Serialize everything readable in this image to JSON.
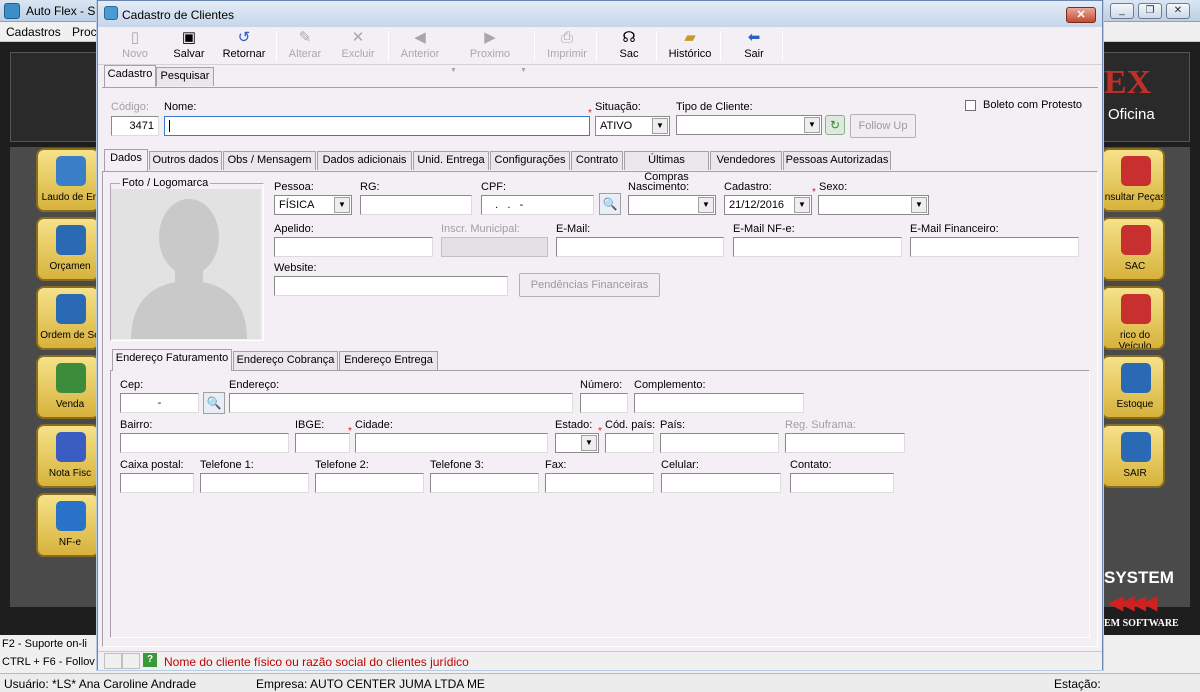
{
  "background_app": {
    "title": "Auto Flex - Si",
    "menu": [
      "Cadastros",
      "Proc"
    ],
    "brand_text": "EX",
    "brand_subtext": "Oficina",
    "left_tiles": [
      "Laudo de En",
      "Orçamen",
      "Ordem de Se",
      "Venda",
      "Nota Fisc",
      "NF-e"
    ],
    "right_tiles": [
      "nsultar Peças",
      "SAC",
      "rico do Veículo",
      "Estoque",
      "SAIR"
    ],
    "system_text": "SYSTEM",
    "arrows_text": "◀◀◀◀",
    "system_subtext": "EM SOFTWARE",
    "shortcuts": [
      "F2 - Suporte on-li",
      "CTRL + F6 - Follov"
    ],
    "status": {
      "usuario": "Usuário: *LS* Ana Caroline Andrade",
      "empresa": "Empresa: AUTO CENTER JUMA LTDA ME",
      "estacao": "Estação:"
    }
  },
  "dialog": {
    "title": "Cadastro de Clientes",
    "toolbar": [
      {
        "id": "novo",
        "label": "Novo",
        "icon": "new-doc-icon",
        "enabled": false
      },
      {
        "id": "salvar",
        "label": "Salvar",
        "icon": "floppy-disk-icon",
        "enabled": true
      },
      {
        "id": "retornar",
        "label": "Retornar",
        "icon": "undo-icon",
        "enabled": true
      },
      {
        "id": "alterar",
        "label": "Alterar",
        "icon": "pencil-icon",
        "enabled": false
      },
      {
        "id": "excluir",
        "label": "Excluir",
        "icon": "delete-x-icon",
        "enabled": false
      },
      {
        "id": "anterior",
        "label": "Anterior",
        "icon": "arrow-left-icon",
        "enabled": false
      },
      {
        "id": "proximo",
        "label": "Proximo",
        "icon": "arrow-right-icon",
        "enabled": false
      },
      {
        "id": "imprimir",
        "label": "Imprimir",
        "icon": "printer-icon",
        "enabled": false
      },
      {
        "id": "sac",
        "label": "Sac",
        "icon": "headset-icon",
        "enabled": true
      },
      {
        "id": "historico",
        "label": "Histórico",
        "icon": "folder-open-icon",
        "enabled": true
      },
      {
        "id": "sair",
        "label": "Sair",
        "icon": "exit-arrow-icon",
        "enabled": true
      }
    ],
    "top_tabs": [
      "Cadastro",
      "Pesquisar"
    ],
    "header": {
      "codigo_label": "Código:",
      "codigo_value": "3471",
      "nome_label": "Nome:",
      "nome_value": "",
      "situacao_label": "Situação:",
      "situacao_value": "ATIVO",
      "tipo_label": "Tipo de Cliente:",
      "tipo_value": "",
      "follow_up": "Follow Up",
      "boleto_label": "Boleto com Protesto",
      "boleto_checked": false
    },
    "detail_tabs": [
      "Dados",
      "Outros dados",
      "Obs / Mensagem",
      "Dados adicionais",
      "Unid. Entrega",
      "Configurações",
      "Contrato",
      "Últimas Compras",
      "Vendedores",
      "Pessoas Autorizadas"
    ],
    "dados": {
      "foto_label": "Foto / Logomarca",
      "pessoa_label": "Pessoa:",
      "pessoa_value": "FÍSICA",
      "rg_label": "RG:",
      "cpf_label": "CPF:",
      "cpf_value": "   .   .   -",
      "nascimento_label": "Nascimento:",
      "cadastro_label": "Cadastro:",
      "cadastro_value": "21/12/2016",
      "sexo_label": "Sexo:",
      "apelido_label": "Apelido:",
      "inscr_label": "Inscr. Municipal:",
      "email_label": "E-Mail:",
      "email_nfe_label": "E-Mail NF-e:",
      "email_fin_label": "E-Mail Financeiro:",
      "website_label": "Website:",
      "pendencias": "Pendências Financeiras"
    },
    "address_tabs": [
      "Endereço Faturamento",
      "Endereço Cobrança",
      "Endereço Entrega"
    ],
    "endereco": {
      "cep_label": "Cep:",
      "cep_value": "-",
      "endereco_label": "Endereço:",
      "numero_label": "Número:",
      "complemento_label": "Complemento:",
      "bairro_label": "Bairro:",
      "ibge_label": "IBGE:",
      "cidade_label": "Cidade:",
      "estado_label": "Estado:",
      "cod_pais_label": "Cód. país:",
      "pais_label": "País:",
      "suframa_label": "Reg. Suframa:",
      "caixa_label": "Caixa postal:",
      "tel1_label": "Telefone 1:",
      "tel2_label": "Telefone 2:",
      "tel3_label": "Telefone 3:",
      "fax_label": "Fax:",
      "celular_label": "Celular:",
      "contato_label": "Contato:"
    },
    "status_hint": "Nome do cliente físico ou razão social do clientes jurídico",
    "hint_color": "#c00000"
  }
}
